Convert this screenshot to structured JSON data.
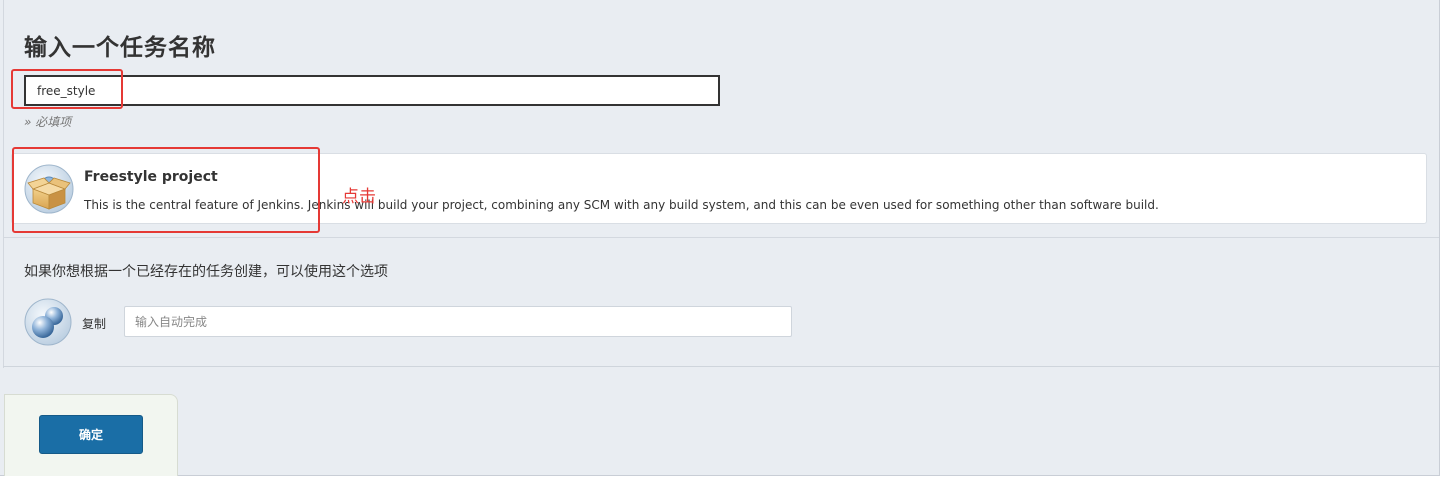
{
  "title": "输入一个任务名称",
  "name_input": {
    "value": "free_style",
    "required_hint": "» 必填项"
  },
  "item_types": [
    {
      "title": "Freestyle project",
      "description": "This is the central feature of Jenkins. Jenkins will build your project, combining any SCM with any build system, and this can be even used for something other than software build.",
      "icon": "package-box-icon"
    }
  ],
  "copy": {
    "hint": "如果你想根据一个已经存在的任务创建，可以使用这个选项",
    "label": "复制",
    "placeholder": "输入自动完成",
    "icon": "copy-spheres-icon"
  },
  "ok_button_label": "确定",
  "annotation": {
    "text": "点击",
    "color": "#e53935"
  },
  "colors": {
    "background": "#e9edf2",
    "primary_button": "#1a6ea6"
  }
}
